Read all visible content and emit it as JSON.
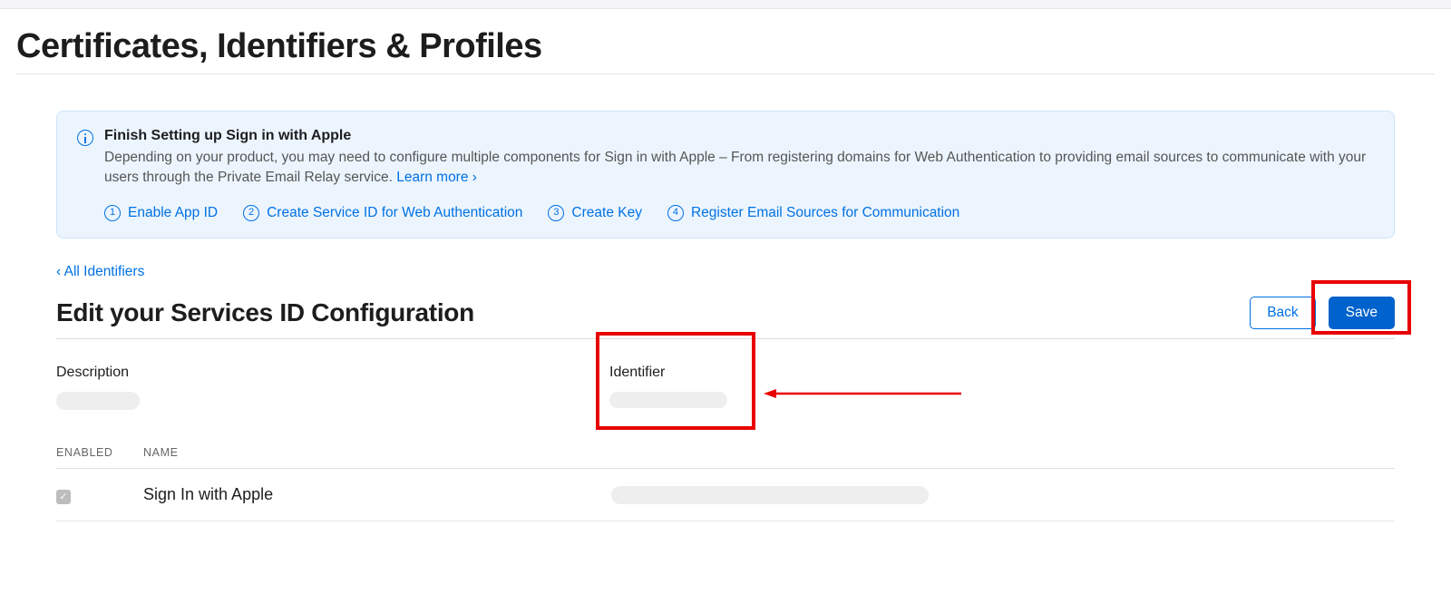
{
  "page_title": "Certificates, Identifiers & Profiles",
  "notice": {
    "title": "Finish Setting up Sign in with Apple",
    "body_a": "Depending on your product, you may need to configure multiple components for Sign in with Apple – From registering domains for Web Authentication to providing email sources to communicate with your users through the Private Email Relay service. ",
    "learn_more": "Learn more ›",
    "steps": [
      {
        "num": "1",
        "label": "Enable App ID"
      },
      {
        "num": "2",
        "label": "Create Service ID for Web Authentication"
      },
      {
        "num": "3",
        "label": "Create Key"
      },
      {
        "num": "4",
        "label": "Register Email Sources for Communication"
      }
    ]
  },
  "back_link": "‹ All Identifiers",
  "config": {
    "title": "Edit your Services ID Configuration",
    "back_label": "Back",
    "save_label": "Save"
  },
  "fields": {
    "description_label": "Description",
    "identifier_label": "Identifier"
  },
  "table": {
    "col_enabled": "ENABLED",
    "col_name": "NAME",
    "rows": [
      {
        "enabled": true,
        "name": "Sign In with Apple"
      }
    ]
  }
}
